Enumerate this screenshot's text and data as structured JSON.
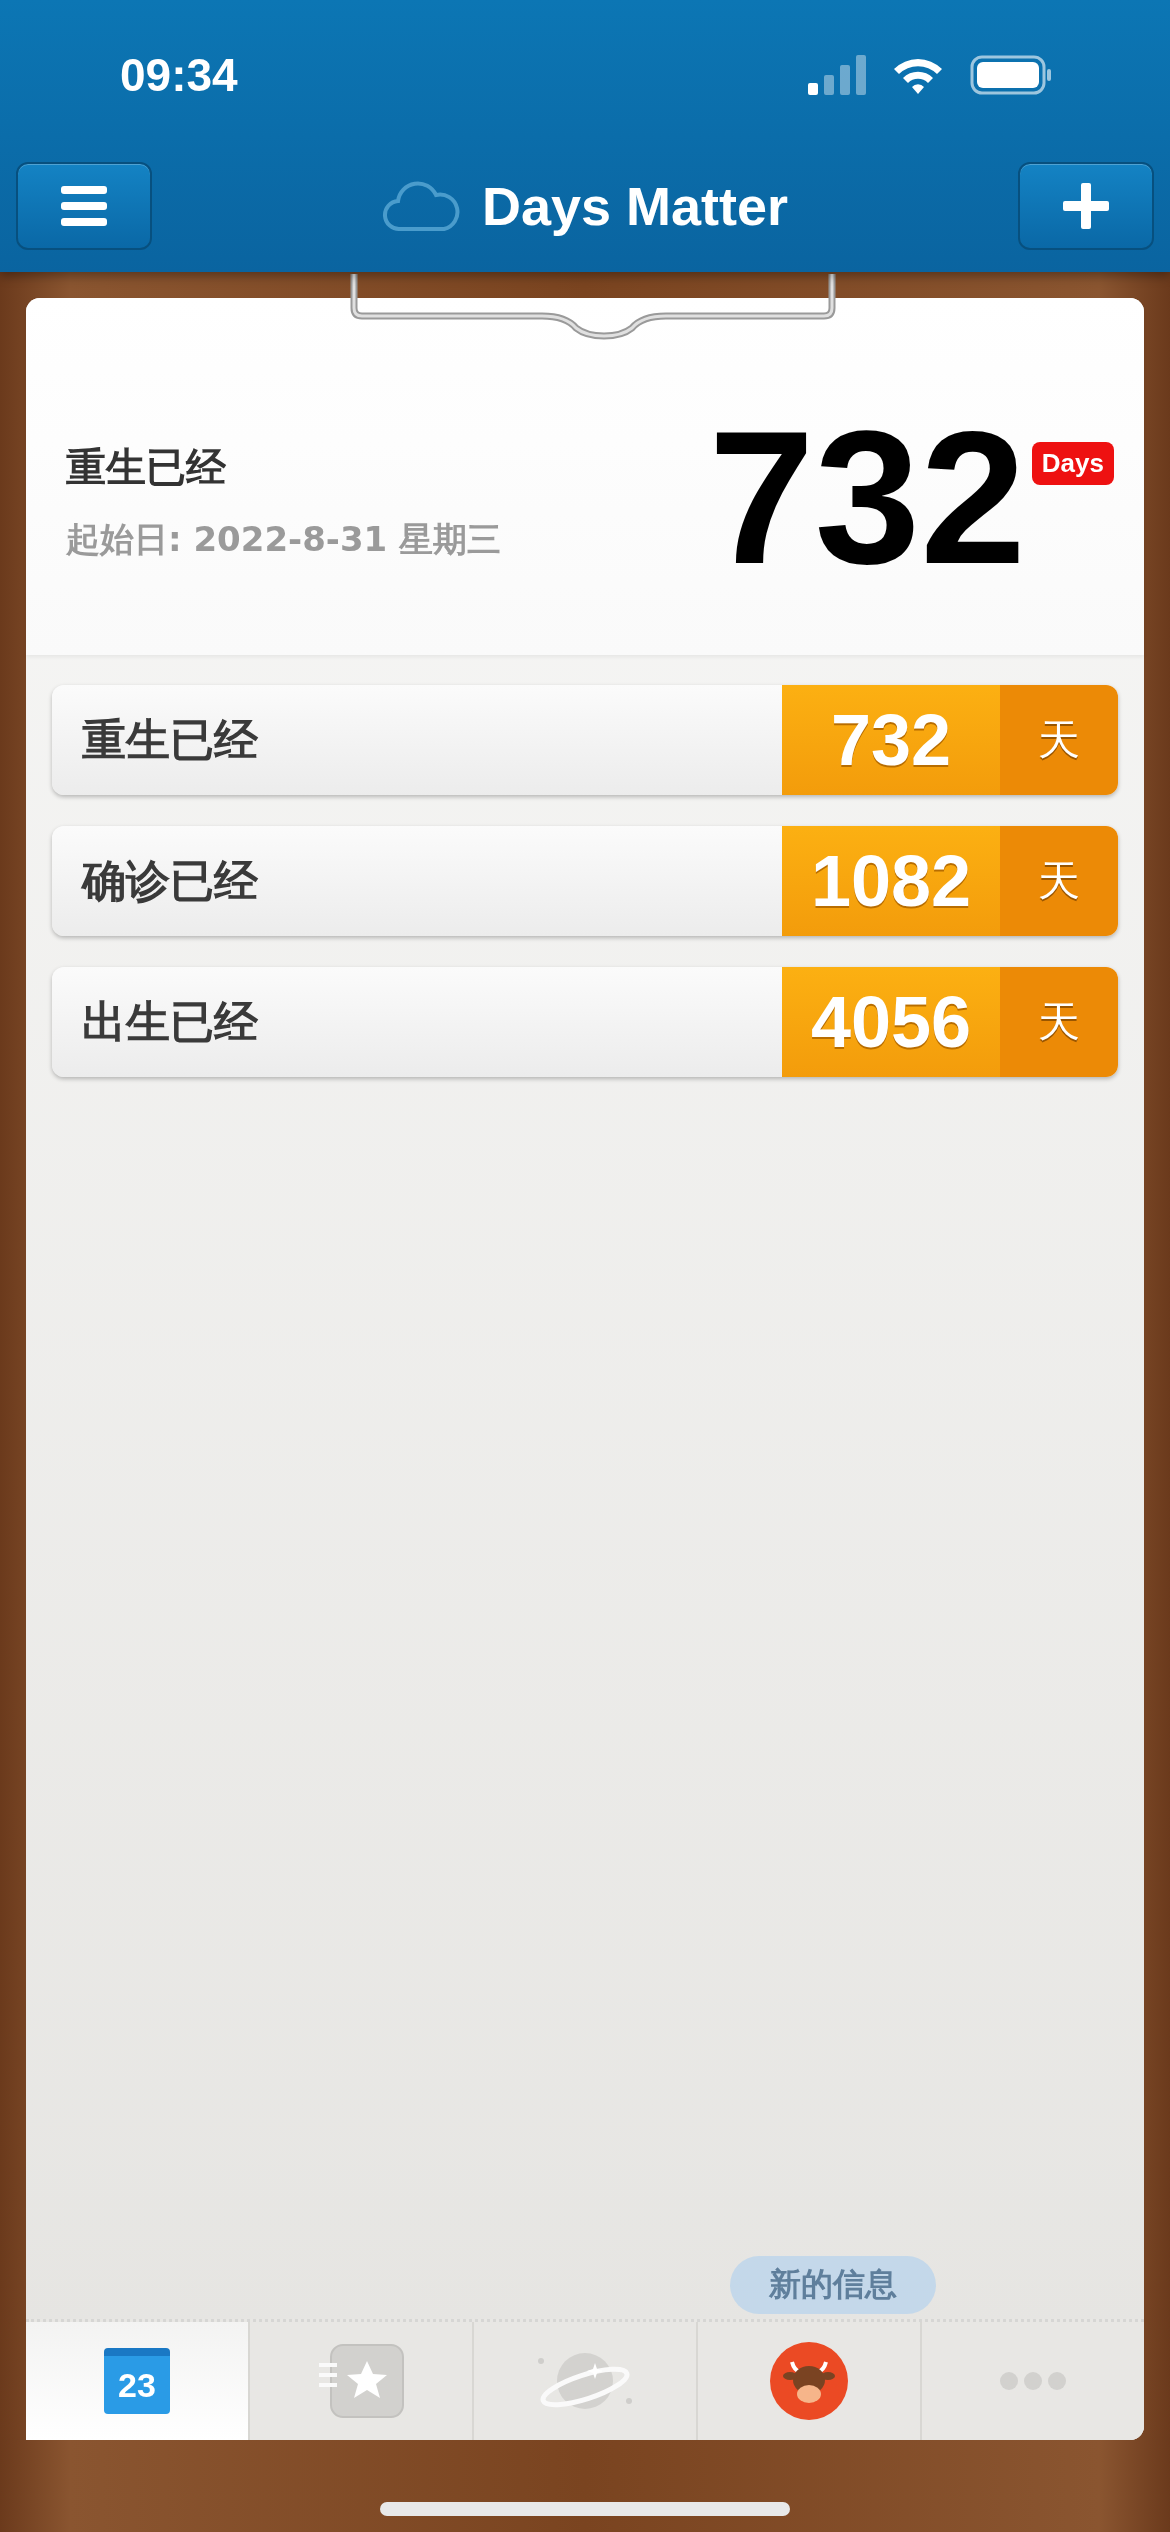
{
  "status_bar": {
    "time": "09:34"
  },
  "nav_bar": {
    "title": "Days Matter"
  },
  "featured": {
    "title": "重生已经",
    "start_date": "起始日: 2022-8-31 星期三",
    "count": "732",
    "badge": "Days"
  },
  "events": [
    {
      "title": "重生已经",
      "count": "732",
      "unit": "天"
    },
    {
      "title": "确诊已经",
      "count": "1082",
      "unit": "天"
    },
    {
      "title": "出生已经",
      "count": "4056",
      "unit": "天"
    }
  ],
  "tooltip": "新的信息",
  "tabs": [
    {
      "kind": "calendar",
      "icon_text": "23",
      "selected": true
    },
    {
      "kind": "starred",
      "selected": false
    },
    {
      "kind": "discover",
      "selected": false
    },
    {
      "kind": "avatar",
      "selected": false
    },
    {
      "kind": "more",
      "selected": false
    }
  ]
}
